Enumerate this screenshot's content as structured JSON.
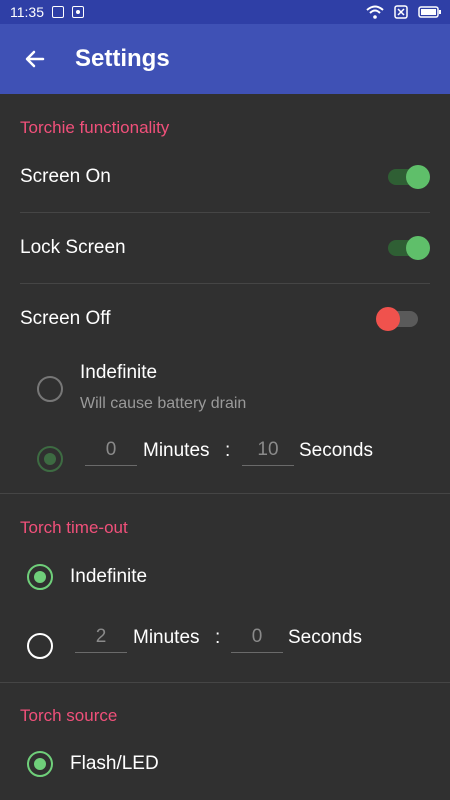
{
  "status": {
    "time": "11:35"
  },
  "appbar": {
    "title": "Settings"
  },
  "sections": {
    "functionality": {
      "title": "Torchie functionality",
      "screen_on": {
        "label": "Screen On",
        "enabled": true
      },
      "lock_screen": {
        "label": "Lock Screen",
        "enabled": true
      },
      "screen_off": {
        "label": "Screen Off",
        "enabled": false,
        "indefinite": {
          "label": "Indefinite",
          "sub": "Will cause battery drain",
          "selected": false
        },
        "timed": {
          "minutes": "0",
          "minutes_label": "Minutes",
          "separator": ":",
          "seconds": "10",
          "seconds_label": "Seconds",
          "selected": true
        }
      }
    },
    "timeout": {
      "title": "Torch time-out",
      "indefinite": {
        "label": "Indefinite",
        "selected": true
      },
      "timed": {
        "minutes": "2",
        "minutes_label": "Minutes",
        "separator": ":",
        "seconds": "0",
        "seconds_label": "Seconds",
        "selected": false
      }
    },
    "source": {
      "title": "Torch source",
      "flash": {
        "label": "Flash/LED",
        "selected": true
      }
    }
  },
  "colors": {
    "accent": "#f0507a",
    "appbar": "#3f51b5",
    "statusbar": "#2f3fa6",
    "green": "#5fbf6a",
    "red": "#f0524d",
    "background": "#303030"
  }
}
